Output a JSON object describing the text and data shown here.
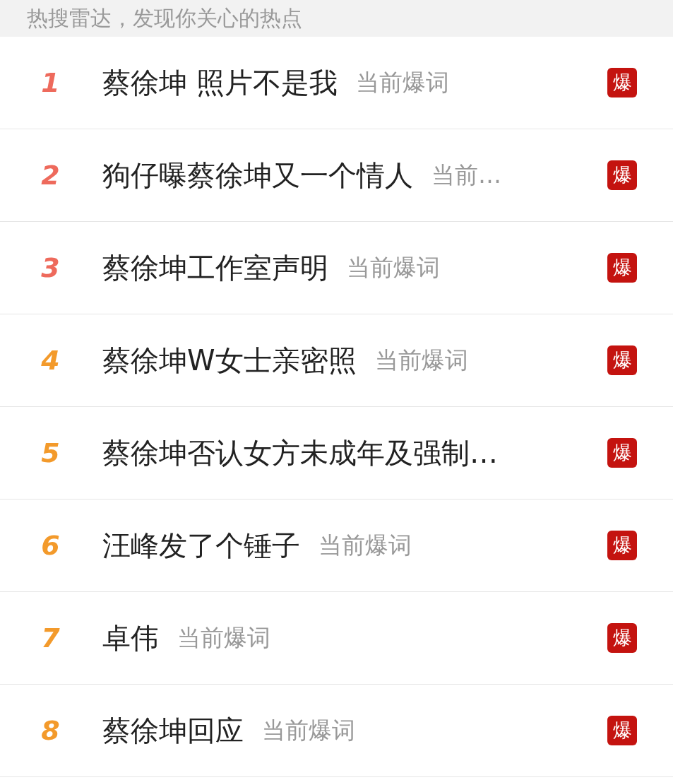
{
  "header": {
    "text": "热搜雷达，发现你关心的热点"
  },
  "items": [
    {
      "rank": "1",
      "color": "#ee6a5c",
      "title": "蔡徐坤 照片不是我",
      "tag": "当前爆词",
      "badge": "爆"
    },
    {
      "rank": "2",
      "color": "#ee6a5c",
      "title": "狗仔曝蔡徐坤又一个情人",
      "tag": "当前…",
      "badge": "爆"
    },
    {
      "rank": "3",
      "color": "#ee6a5c",
      "title": "蔡徐坤工作室声明",
      "tag": "当前爆词",
      "badge": "爆"
    },
    {
      "rank": "4",
      "color": "#f39a2b",
      "title": "蔡徐坤W女士亲密照",
      "tag": "当前爆词",
      "badge": "爆"
    },
    {
      "rank": "5",
      "color": "#f39a2b",
      "title": "蔡徐坤否认女方未成年及强制…",
      "badge": "爆"
    },
    {
      "rank": "6",
      "color": "#f39a2b",
      "title": "汪峰发了个锤子",
      "tag": "当前爆词",
      "badge": "爆"
    },
    {
      "rank": "7",
      "color": "#f39a2b",
      "title": "卓伟",
      "tag": "当前爆词",
      "badge": "爆"
    },
    {
      "rank": "8",
      "color": "#f39a2b",
      "title": "蔡徐坤回应",
      "tag": "当前爆词",
      "badge": "爆"
    }
  ]
}
